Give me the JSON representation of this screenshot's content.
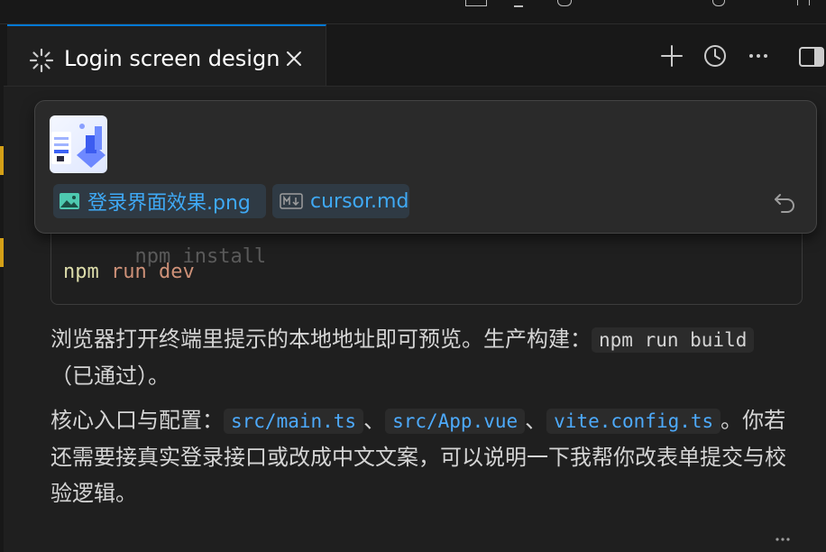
{
  "tab": {
    "title": "Login screen design",
    "actions": [
      "plus-icon",
      "history-icon",
      "more-icon",
      "toggle-panel-icon"
    ]
  },
  "attachment": {
    "thumbnail_alt": "登录界面效果.png preview",
    "chips": [
      {
        "icon": "image-icon",
        "label": "登录界面效果.png"
      },
      {
        "icon": "markdown-icon",
        "label": "cursor.md"
      }
    ],
    "undo_icon": "undo-icon"
  },
  "code_block": {
    "partial_line": "npm install",
    "line": {
      "cmd": "npm",
      "args": "run dev"
    }
  },
  "paragraph1": {
    "text": "浏览器打开终端里提示的本地地址即可预览。生产构建：",
    "code": "npm run build",
    "suffix": "（已通过）。"
  },
  "paragraph2": {
    "prefix": "核心入口与配置：",
    "files": [
      "src/main.ts",
      "src/App.vue",
      "vite.config.ts"
    ],
    "separator": "、",
    "suffix": "。你若还需要接真实登录接口或改成中文文案，可以说明一下我帮你改表单提交与校验逻辑。"
  },
  "colors": {
    "accent": "#0078d4",
    "link": "#4daafc",
    "chip_text": "#3fa9f5",
    "marker": "#d4a017"
  }
}
